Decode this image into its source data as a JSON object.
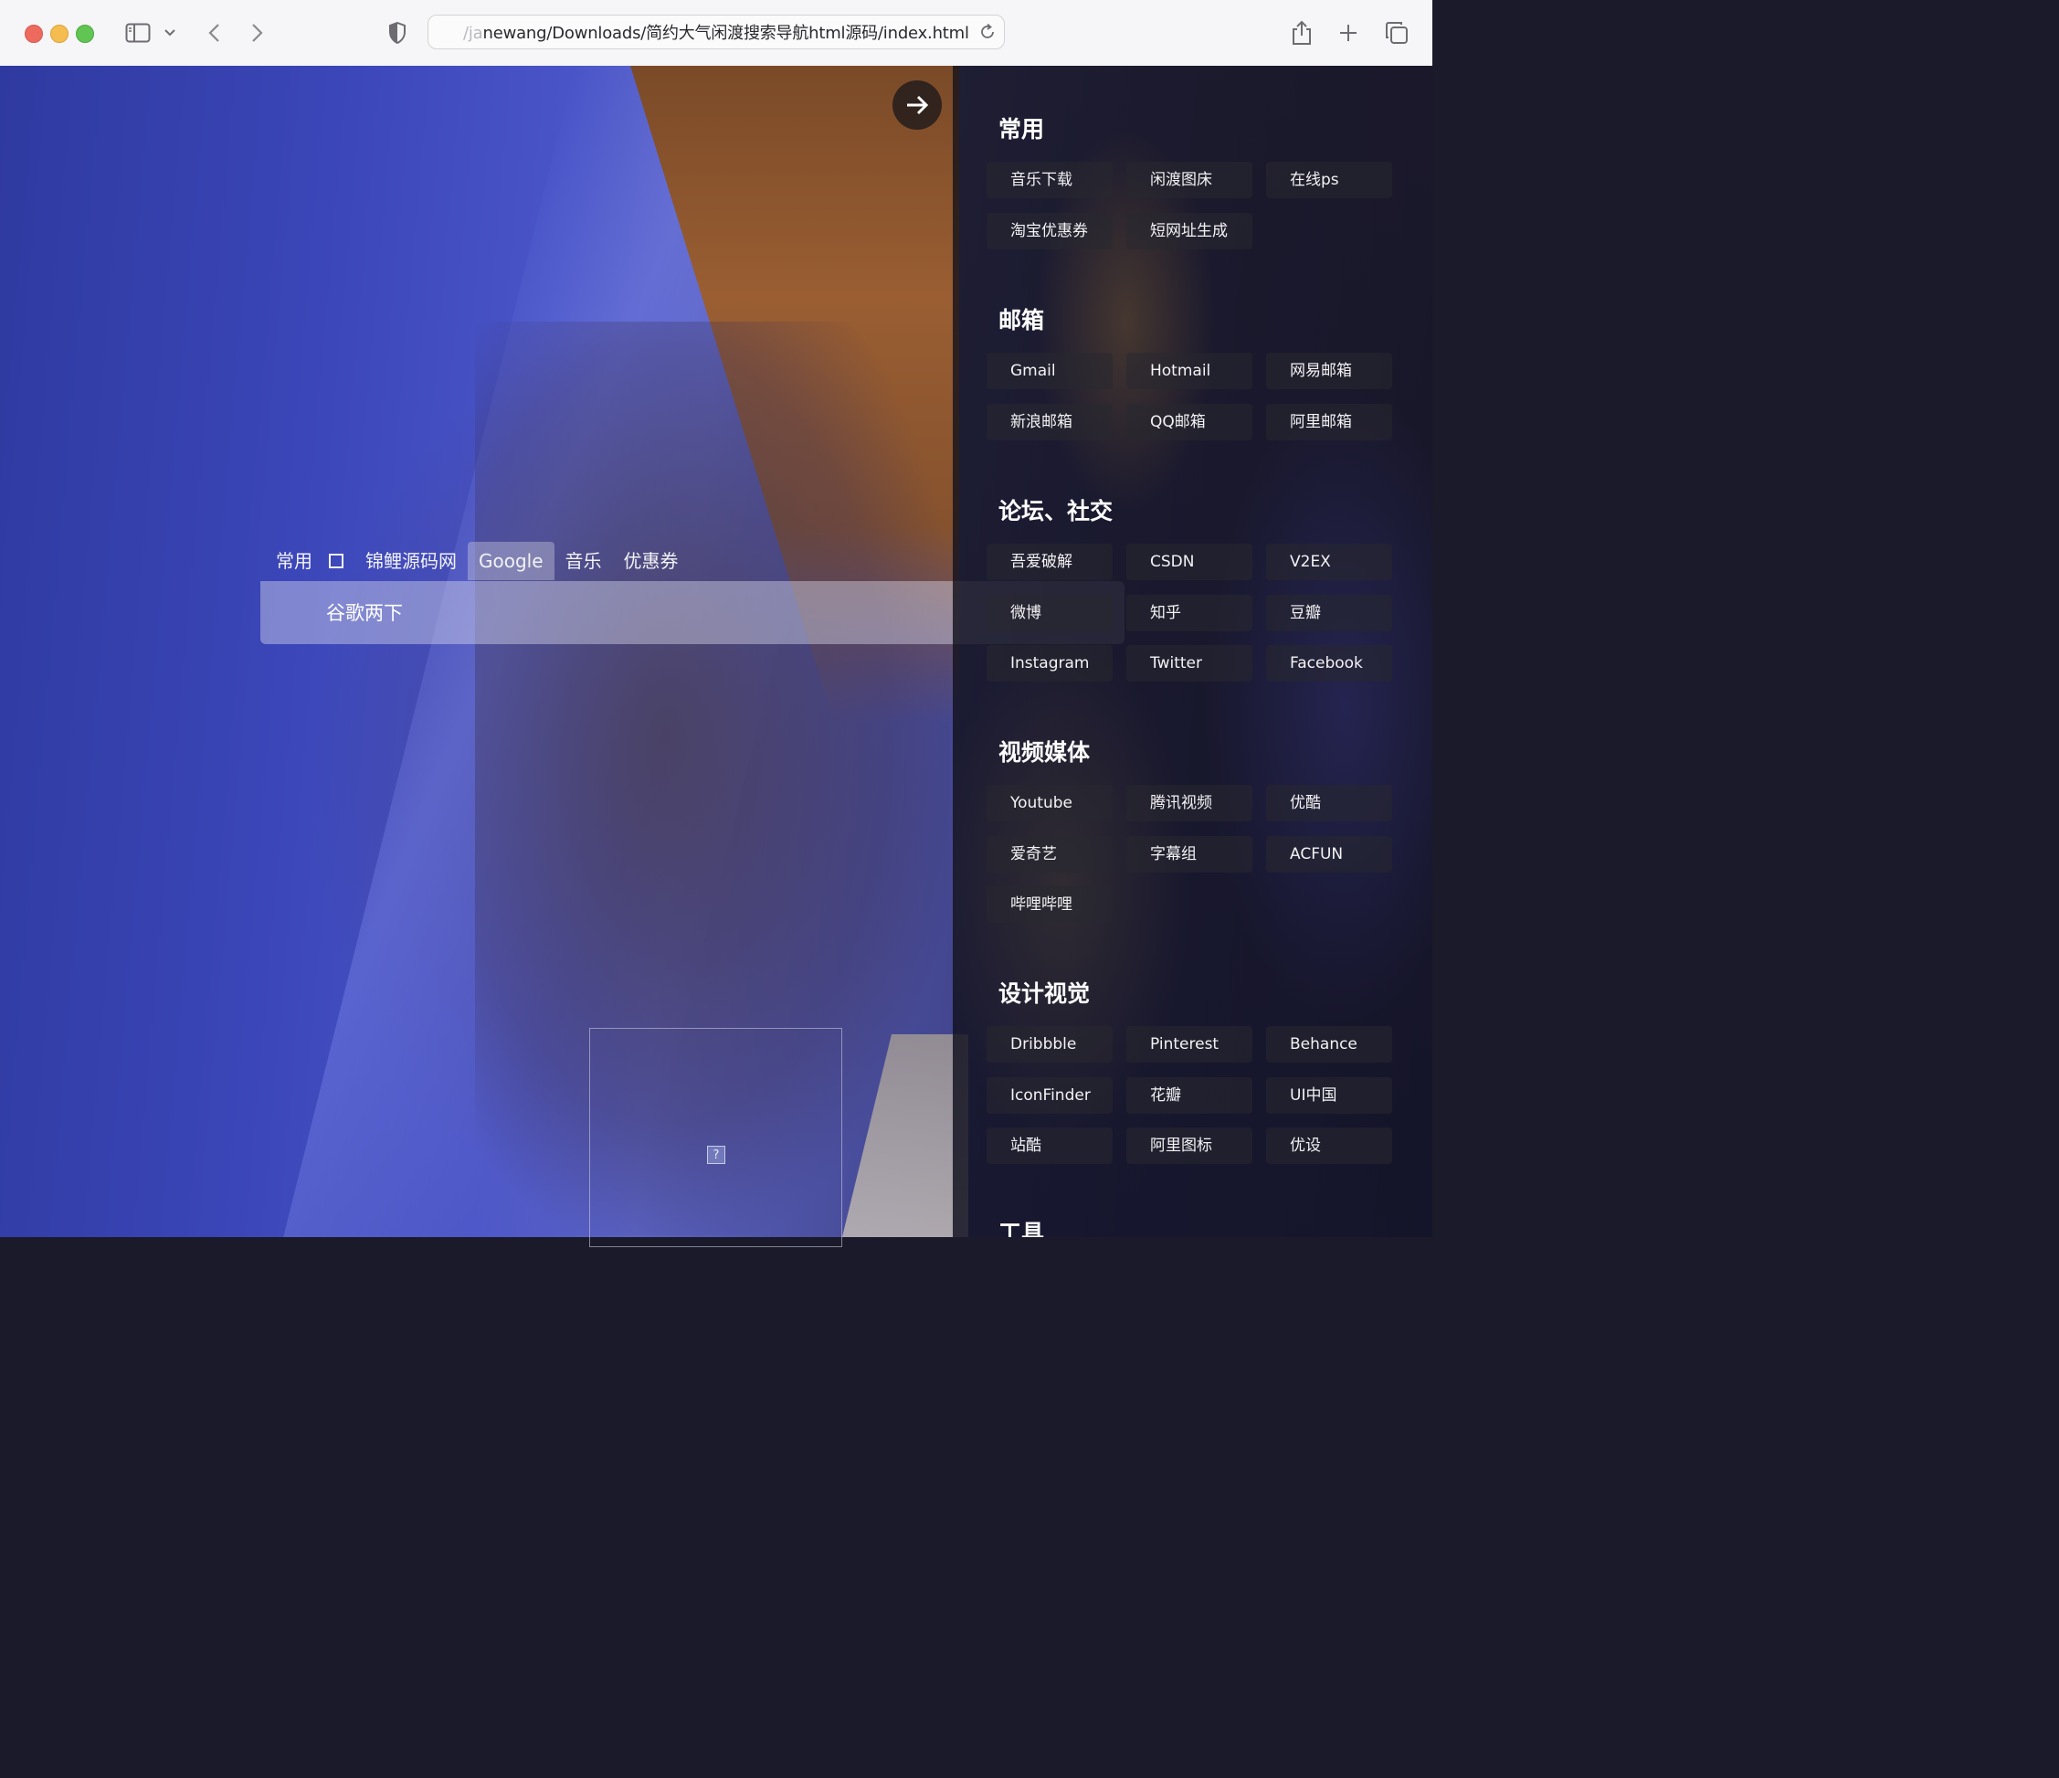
{
  "browser": {
    "url_faded": "/ja",
    "url_main": "newang/Downloads/简约大气闲渡搜索导航html源码/index.html"
  },
  "search": {
    "tabs": [
      "常用",
      "锦鲤源码网",
      "Google",
      "音乐",
      "优惠券"
    ],
    "active_tab": "Google",
    "placeholder": "谷歌两下"
  },
  "panel": {
    "sections": [
      {
        "title": "常用",
        "links": [
          "音乐下载",
          "闲渡图床",
          "在线ps",
          "淘宝优惠券",
          "短网址生成"
        ]
      },
      {
        "title": "邮箱",
        "links": [
          "Gmail",
          "Hotmail",
          "网易邮箱",
          "新浪邮箱",
          "QQ邮箱",
          "阿里邮箱"
        ]
      },
      {
        "title": "论坛、社交",
        "links": [
          "吾爱破解",
          "CSDN",
          "V2EX",
          "微博",
          "知乎",
          "豆瓣",
          "Instagram",
          "Twitter",
          "Facebook"
        ]
      },
      {
        "title": "视频媒体",
        "links": [
          "Youtube",
          "腾讯视频",
          "优酷",
          "爱奇艺",
          "字幕组",
          "ACFUN",
          "哔哩哔哩"
        ]
      },
      {
        "title": "设计视觉",
        "links": [
          "Dribbble",
          "Pinterest",
          "Behance",
          "IconFinder",
          "花瓣",
          "UI中国",
          "站酷",
          "阿里图标",
          "优设"
        ]
      },
      {
        "title": "工具",
        "links": []
      }
    ]
  },
  "broken_image_glyph": "?"
}
